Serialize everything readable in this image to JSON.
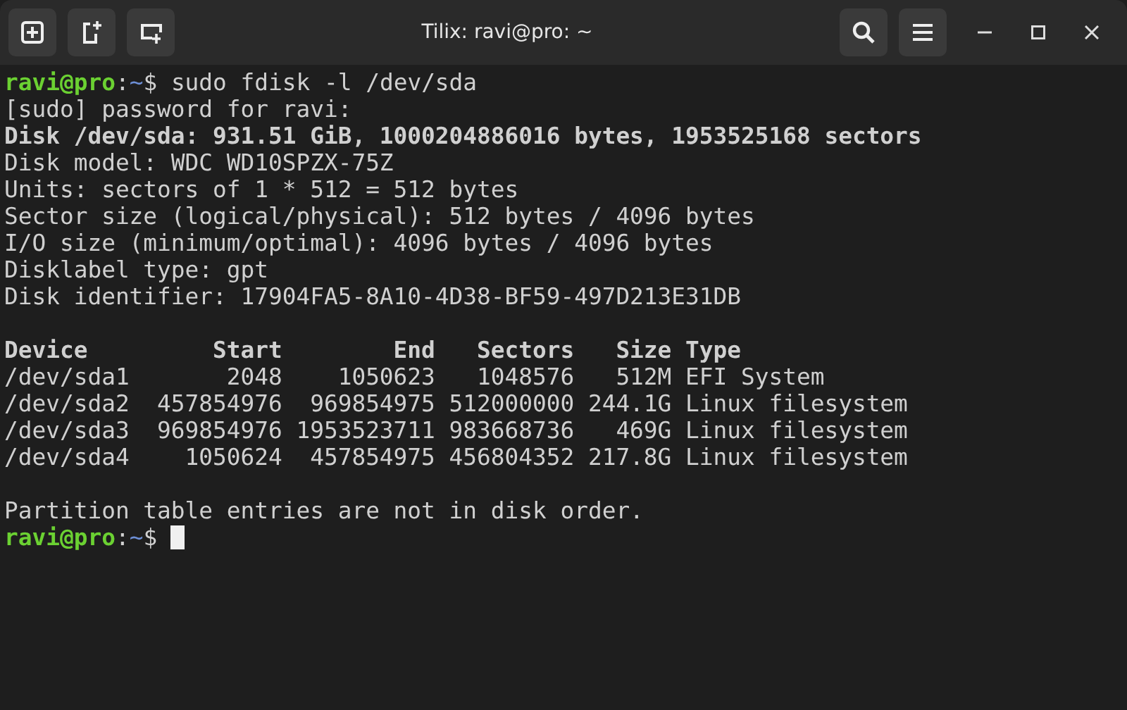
{
  "window": {
    "title": "Tilix: ravi@pro: ~"
  },
  "terminal": {
    "lines": [
      {
        "kind": "prompt",
        "user_host": "ravi@pro",
        "separator": ":",
        "path": "~",
        "symbol": "$",
        "command": "sudo fdisk -l /dev/sda",
        "cursor": false
      },
      {
        "kind": "output",
        "text": "[sudo] password for ravi:",
        "bold": false
      },
      {
        "kind": "output",
        "text": "Disk /dev/sda: 931.51 GiB, 1000204886016 bytes, 1953525168 sectors",
        "bold": true
      },
      {
        "kind": "output",
        "text": "Disk model: WDC WD10SPZX-75Z",
        "bold": false
      },
      {
        "kind": "output",
        "text": "Units: sectors of 1 * 512 = 512 bytes",
        "bold": false
      },
      {
        "kind": "output",
        "text": "Sector size (logical/physical): 512 bytes / 4096 bytes",
        "bold": false
      },
      {
        "kind": "output",
        "text": "I/O size (minimum/optimal): 4096 bytes / 4096 bytes",
        "bold": false
      },
      {
        "kind": "output",
        "text": "Disklabel type: gpt",
        "bold": false
      },
      {
        "kind": "output",
        "text": "Disk identifier: 17904FA5-8A10-4D38-BF59-497D213E31DB",
        "bold": false
      },
      {
        "kind": "blank"
      },
      {
        "kind": "output",
        "text": "Device         Start        End   Sectors   Size Type",
        "bold": true
      },
      {
        "kind": "output",
        "text": "/dev/sda1       2048    1050623   1048576   512M EFI System",
        "bold": false
      },
      {
        "kind": "output",
        "text": "/dev/sda2  457854976  969854975 512000000 244.1G Linux filesystem",
        "bold": false
      },
      {
        "kind": "output",
        "text": "/dev/sda3  969854976 1953523711 983668736   469G Linux filesystem",
        "bold": false
      },
      {
        "kind": "output",
        "text": "/dev/sda4    1050624  457854975 456804352 217.8G Linux filesystem",
        "bold": false
      },
      {
        "kind": "blank"
      },
      {
        "kind": "output",
        "text": "Partition table entries are not in disk order.",
        "bold": false
      },
      {
        "kind": "prompt",
        "user_host": "ravi@pro",
        "separator": ":",
        "path": "~",
        "symbol": "$",
        "cursor": true
      }
    ]
  }
}
